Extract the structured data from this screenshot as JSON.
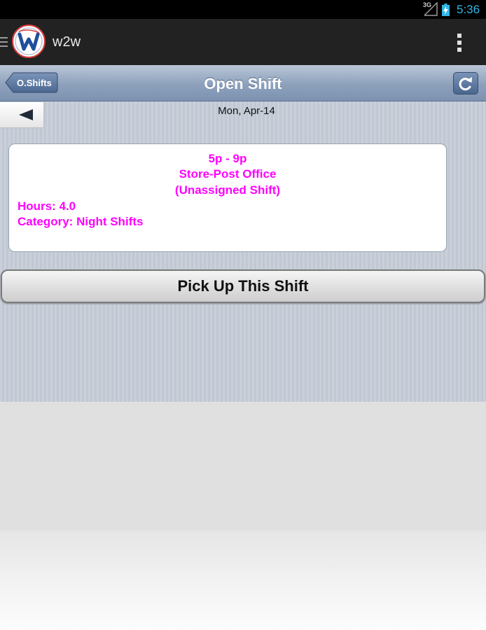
{
  "status_bar": {
    "network_label": "3G",
    "time": "5:36",
    "icons": [
      "signal-icon",
      "battery-charging-icon"
    ],
    "time_color": "#33b5e5"
  },
  "action_bar": {
    "app_title": "w2w",
    "logo_letter": "W",
    "icons": [
      "drawer-menu-icon",
      "app-logo",
      "overflow-menu-icon"
    ]
  },
  "nav_bar": {
    "back_label": "O.Shifts",
    "title": "Open Shift",
    "refresh_icon": "refresh-icon"
  },
  "content": {
    "date": "Mon, Apr-14",
    "prev_icon": "left-arrow-icon",
    "shift": {
      "time": "5p - 9p",
      "location": "Store-Post Office",
      "status": "(Unassigned Shift)",
      "hours": "Hours: 4.0",
      "category": "Category: Night Shifts"
    },
    "shift_text_color": "#ff00ff",
    "action_button": "Pick Up This Shift"
  }
}
